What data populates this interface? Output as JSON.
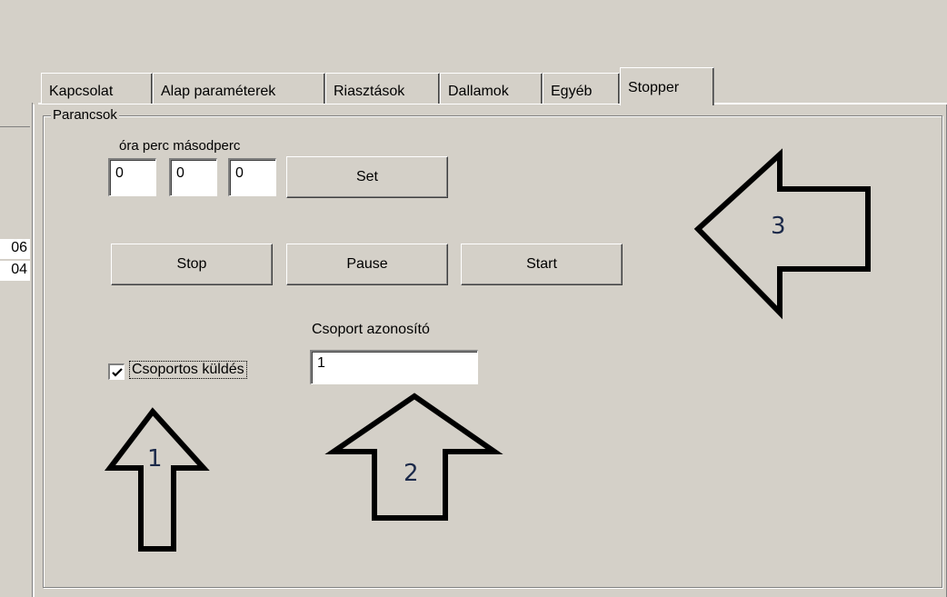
{
  "left_list": {
    "cells": [
      "06",
      "04"
    ]
  },
  "tabs": [
    {
      "label": "Kapcsolat",
      "active": false
    },
    {
      "label": "Alap paraméterek",
      "active": false
    },
    {
      "label": "Riasztások",
      "active": false
    },
    {
      "label": "Dallamok",
      "active": false
    },
    {
      "label": "Egyéb",
      "active": false
    },
    {
      "label": "Stopper",
      "active": true
    }
  ],
  "group": {
    "title": "Parancsok"
  },
  "time": {
    "header_label": "óra perc másodperc",
    "hours": "0",
    "minutes": "0",
    "seconds": "0",
    "set_label": "Set"
  },
  "controls": {
    "stop_label": "Stop",
    "pause_label": "Pause",
    "start_label": "Start"
  },
  "group_send": {
    "checkbox_label": "Csoportos küldés",
    "checked": true
  },
  "group_id": {
    "label": "Csoport azonosító",
    "value": "1"
  },
  "annotations": {
    "arrow1": "1",
    "arrow2": "2",
    "arrow3": "3"
  }
}
